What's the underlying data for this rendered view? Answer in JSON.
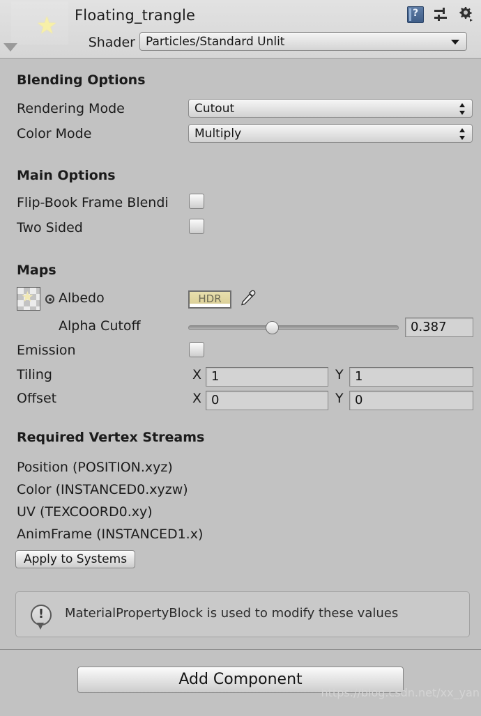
{
  "header": {
    "title": "Floating_trangle",
    "preview_icon": "star-icon",
    "icons": [
      {
        "name": "help-icon",
        "label": "?"
      },
      {
        "name": "preset-icon",
        "label": ""
      },
      {
        "name": "gear-icon",
        "label": ""
      }
    ]
  },
  "shader": {
    "label": "Shader",
    "value": "Particles/Standard Unlit"
  },
  "blending": {
    "heading": "Blending Options",
    "rendering_mode": {
      "label": "Rendering Mode",
      "value": "Cutout"
    },
    "color_mode": {
      "label": "Color Mode",
      "value": "Multiply"
    }
  },
  "main_options": {
    "heading": "Main Options",
    "flipbook": {
      "label": "Flip-Book Frame Blendi",
      "checked": false
    },
    "two_sided": {
      "label": "Two Sided",
      "checked": false
    }
  },
  "maps": {
    "heading": "Maps",
    "albedo": {
      "label": "Albedo",
      "swatch_label": "HDR",
      "swatch_color": "#ded2a0",
      "picker_icon": "eyedropper-icon"
    },
    "alpha_cutoff": {
      "label": "Alpha Cutoff",
      "value": "0.387",
      "percent": 38.7
    },
    "emission": {
      "label": "Emission",
      "checked": false
    },
    "tiling": {
      "label": "Tiling",
      "x_label": "X",
      "x": "1",
      "y_label": "Y",
      "y": "1"
    },
    "offset": {
      "label": "Offset",
      "x_label": "X",
      "x": "0",
      "y_label": "Y",
      "y": "0"
    }
  },
  "vertex_streams": {
    "heading": "Required Vertex Streams",
    "items": [
      "Position (POSITION.xyz)",
      "Color (INSTANCED0.xyzw)",
      "UV (TEXCOORD0.xy)",
      "AnimFrame (INSTANCED1.x)"
    ],
    "apply_button": "Apply to Systems"
  },
  "help": {
    "icon": "info-bubble-icon",
    "message": "MaterialPropertyBlock is used to modify these values"
  },
  "footer": {
    "add_component": "Add Component",
    "watermark": "https://blog.csdn.net/xx_yan"
  }
}
